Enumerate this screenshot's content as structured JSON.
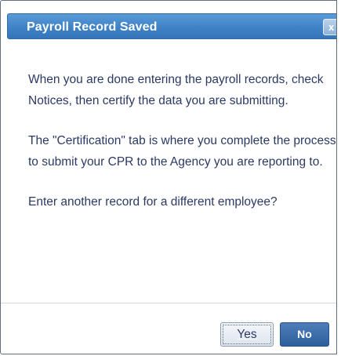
{
  "dialog": {
    "title": "Payroll Record Saved",
    "close_label": "x",
    "paragraphs": [
      "When you are done entering the payroll records, check Notices, then certify the data you are submitting.",
      "The \"Certification\" tab is where you complete the process to submit your CPR to the Agency you are reporting to.",
      "Enter another record for a different employee?"
    ],
    "buttons": {
      "yes_label": "Yes",
      "no_label": "No"
    }
  },
  "colors": {
    "title_bar": "#3f82c6",
    "body_text": "#2b3a63",
    "primary_button": "#2d5f9c"
  },
  "icons": {
    "close": "close-icon"
  }
}
